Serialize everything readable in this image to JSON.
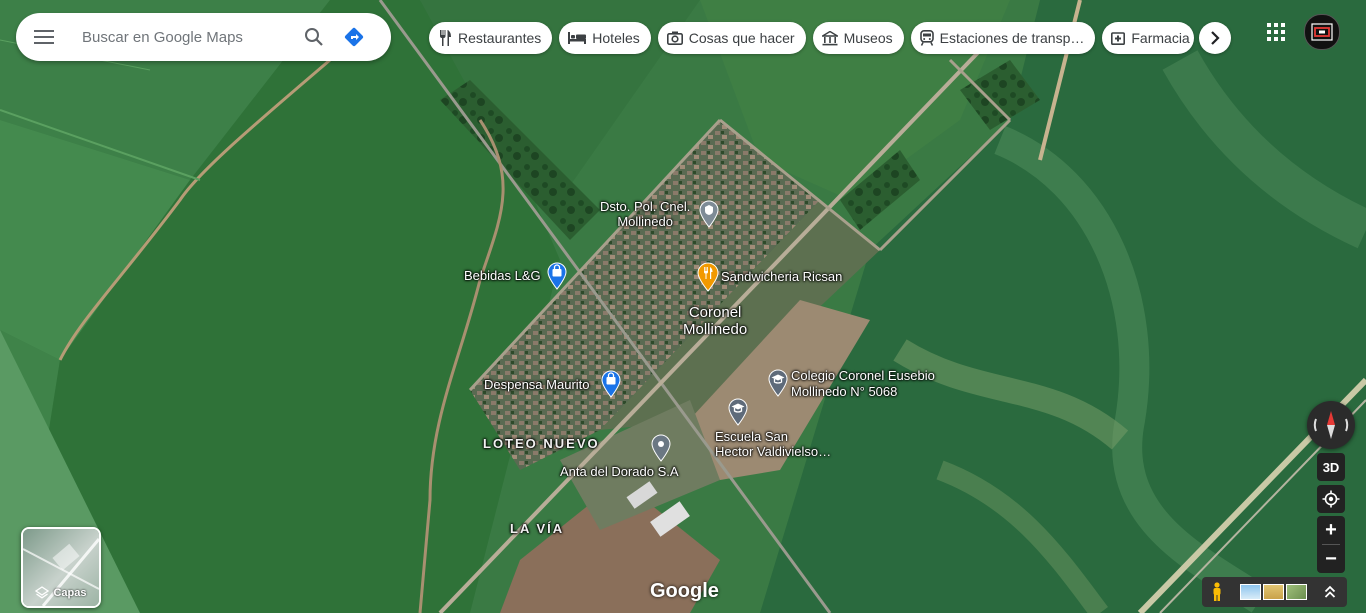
{
  "search": {
    "placeholder": "Buscar en Google Maps"
  },
  "chips": [
    {
      "label": "Restaurantes",
      "icon": "fork-knife-icon"
    },
    {
      "label": "Hoteles",
      "icon": "bed-icon"
    },
    {
      "label": "Cosas que hacer",
      "icon": "camera-icon"
    },
    {
      "label": "Museos",
      "icon": "museum-icon"
    },
    {
      "label": "Estaciones de transp…",
      "icon": "train-icon"
    },
    {
      "label": "Farmacia",
      "icon": "pharmacy-icon"
    }
  ],
  "places": {
    "police": {
      "line1": "Dsto. Pol. Cnel.",
      "line2": "Mollinedo"
    },
    "bebidas": "Bebidas L&G",
    "sandwicheria": "Sandwicheria Ricsan",
    "town": {
      "line1": "Coronel",
      "line2": "Mollinedo"
    },
    "colegio": {
      "line1": "Colegio Coronel Eusebio",
      "line2": "Mollinedo N° 5068"
    },
    "despensa": "Despensa Maurito",
    "loteo": "LOTEO NUEVO",
    "escuela": {
      "line1": "Escuela San",
      "line2": "Hector Valdivielso…"
    },
    "anta": "Anta del Dorado S.A",
    "lavia": "LA VÍA"
  },
  "controls": {
    "layers_label": "Capas",
    "threed": "3D",
    "zoom_in": "+",
    "zoom_out": "−",
    "brand": "Google"
  },
  "colors": {
    "accent": "#1a73e8",
    "food_pin": "#f29900",
    "shop_pin": "#1a73e8",
    "edu_pin": "#5f6b7a"
  }
}
